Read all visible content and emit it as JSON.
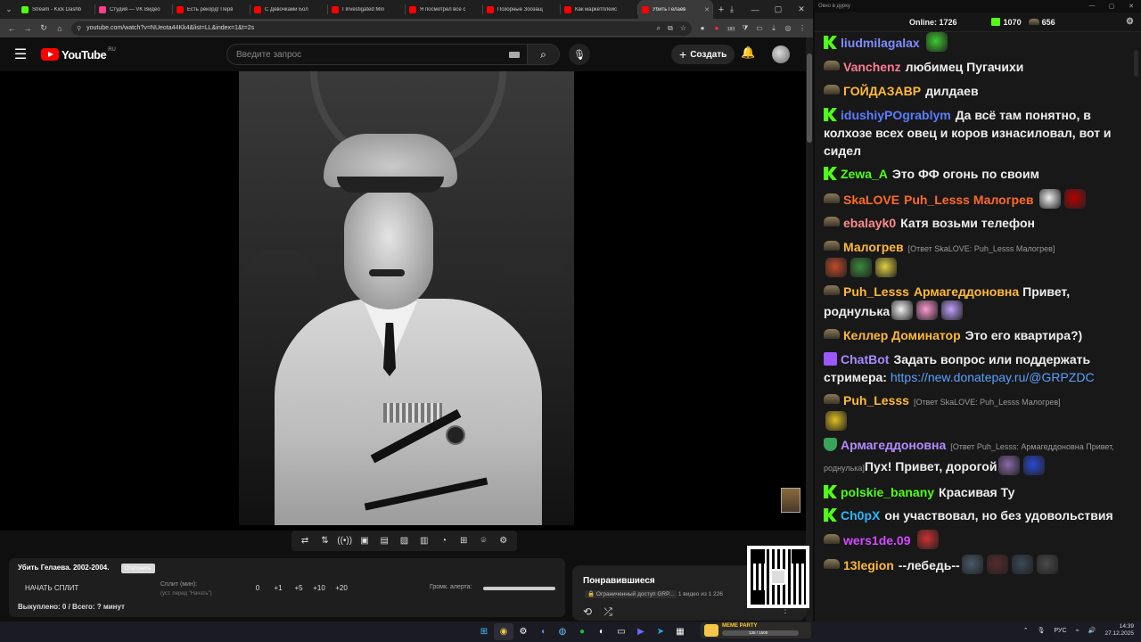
{
  "browser": {
    "tabs": [
      {
        "title": "Stream - Kick Dashb",
        "fav": "kick"
      },
      {
        "title": "Студия — VK Видео",
        "fav": "vk"
      },
      {
        "title": "Есть рекорд! Перв",
        "fav": "yt"
      },
      {
        "title": "С Девочками Бол",
        "fav": "yt"
      },
      {
        "title": "I Investigated Min",
        "fav": "yt"
      },
      {
        "title": "Я посмотрел все с",
        "fav": "yt"
      },
      {
        "title": "Позорные Зоозащ",
        "fav": "yt"
      },
      {
        "title": "Как маркетплейс",
        "fav": "yt"
      },
      {
        "title": "Убить Гелаев",
        "fav": "yt",
        "active": true
      }
    ],
    "url": "youtube.com/watch?v=NUeota44Kk4&list=LL&index=1&t=2s",
    "ext_badge": "183"
  },
  "youtube": {
    "logo": "YouTube",
    "region": "RU",
    "search_placeholder": "Введите запрос",
    "create_label": "Создать"
  },
  "split_panel": {
    "title": "Убить Гелаева. 2002-2004.",
    "tag": "Отклонить",
    "start_label": "НАЧАТЬ СПЛИТ",
    "split_label": "Сплит (мин):",
    "split_sub": "(уст. перед \"Начать\")",
    "minutes": [
      "0",
      "+1",
      "+5",
      "+10",
      "+20"
    ],
    "volume_label": "Громк. алерта:",
    "bought": "Выкуплено: 0 / Всего: ? минут"
  },
  "playlist": {
    "title": "Понравившиеся",
    "access": "Ограниченный доступ",
    "owner": "GRP...",
    "count": "1 видео из 1 226"
  },
  "chat": {
    "window_title": "Окно в дурку",
    "online_label": "Online:",
    "online": "1726",
    "kick_count": "1070",
    "vk_count": "656",
    "messages": [
      {
        "badge": "k",
        "user": "liudmilagalax",
        "color": "#7f8cff",
        "text": "",
        "emotes": [
          "#3ecb2e"
        ]
      },
      {
        "badge": "hat",
        "user": "Vanchenz",
        "color": "#ff7a93",
        "text": "любимец Пугачихи"
      },
      {
        "badge": "hat",
        "user": "ГОЙДАЗАВР",
        "color": "#ffb93b",
        "text": "дилдаев"
      },
      {
        "badge": "k",
        "user": "idushiyPOgrablym",
        "color": "#5b7cff",
        "text": "Да всё там понятно, в колхозе всех овец и коров изнасиловал, вот и сидел"
      },
      {
        "badge": "k",
        "user": "Zewa_A",
        "color": "#53fc18",
        "text": "Это ФФ огонь по своим"
      },
      {
        "badge": "hat",
        "user": "SkaLOVE",
        "color": "#ff6a2a",
        "text": "",
        "mention": "Puh_Lesss Малогрев",
        "mention_color": "#ff6a2a",
        "emotes": [
          "#f0f0f0",
          "#b80000"
        ]
      },
      {
        "badge": "hat",
        "user": "ebalayk0",
        "color": "#ff8a8a",
        "text": "Катя возьми телефон"
      },
      {
        "badge": "hat",
        "user": "Малогрев",
        "color": "#ffb93b",
        "reply": "[Ответ SkaLOVE: Puh_Lesss Малогрев]",
        "text": "",
        "emotes": [
          "#c34a2a",
          "#3a8a3a",
          "#e0d040"
        ],
        "emotes_newline": true
      },
      {
        "badge": "hat",
        "user": "Puh_Lesss",
        "color": "#ffb93b",
        "mention": "Армагеддоновна",
        "mention_color": "#ffb93b",
        "text": "Привет, роднулька",
        "emotes": [
          "#f0f0f0",
          "#ff9ad5",
          "#c0a0ff"
        ]
      },
      {
        "badge": "hat",
        "user": "Келлер Доминатор",
        "color": "#ffb93b",
        "text": "Это его квартира?)"
      },
      {
        "badge": "space",
        "user": "ChatBot",
        "color": "#a98aff",
        "text": "Задать вопрос или поддержать стримера:",
        "link": "https://new.donatepay.ru/@GRPZDC"
      },
      {
        "badge": "hat",
        "user": "Puh_Lesss",
        "color": "#ffb93b",
        "reply": "[Ответ SkaLOVE: Puh_Lesss Малогрев]",
        "text": "",
        "emotes": [
          "#e0c020"
        ],
        "emotes_newline": true
      },
      {
        "badge": "shield",
        "user": "Армагеддоновна",
        "color": "#b48bff",
        "reply": "[Ответ Puh_Lesss: Армагеддоновна Привет, роднулька]",
        "text": "Пух! Привет, дорогой",
        "emotes": [
          "#8a6aa8",
          "#2a4ad8"
        ]
      },
      {
        "badge": "k",
        "user": "polskie_banany",
        "color": "#53fc18",
        "text": "Красивая Ту"
      },
      {
        "badge": "k",
        "user": "Ch0pX",
        "color": "#2ab8ff",
        "text": "он участвовал, но без удовольствия"
      },
      {
        "badge": "hat",
        "user": "wers1de.09",
        "color": "#d34aff",
        "text": "",
        "emotes": [
          "#d03030"
        ]
      },
      {
        "badge": "hat",
        "user": "13legion",
        "color": "#ffb93b",
        "text": "--лебедь--",
        "emotes": [
          "#4a5a6a",
          "#5a2a2a",
          "#3a4a5a",
          "#4a4a4a"
        ]
      }
    ]
  },
  "taskbar": {
    "widget_label": "MEME PARTY",
    "widget_count": "135 / 1500",
    "lang": "РУС",
    "time": "14:39",
    "date": "27.12.2025"
  }
}
